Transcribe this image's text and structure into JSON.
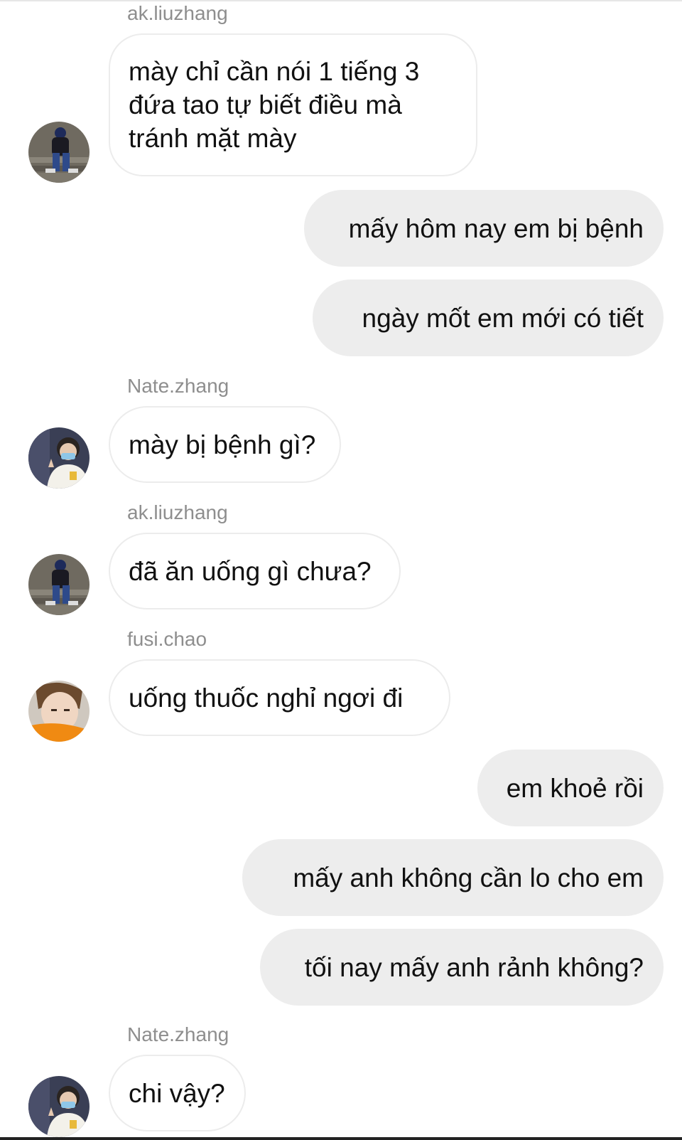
{
  "messages": [
    {
      "sender": "ak.liuzhang",
      "text": "mày chỉ cần nói 1 tiếng 3 đứa tao tự biết điều mà tránh mặt mày"
    },
    {
      "text": "mấy hôm nay em bị bệnh"
    },
    {
      "text": "ngày mốt em mới có tiết"
    },
    {
      "sender": "Nate.zhang",
      "text": "mày bị bệnh gì?"
    },
    {
      "sender": "ak.liuzhang",
      "text": "đã ăn uống gì chưa?"
    },
    {
      "sender": "fusi.chao",
      "text": "uống thuốc nghỉ ngơi đi"
    },
    {
      "text": "em khoẻ rồi"
    },
    {
      "text": "mấy anh không cần lo cho em"
    },
    {
      "text": "tối nay mấy anh rảnh không?"
    },
    {
      "sender": "Nate.zhang",
      "text": "chi vậy?"
    }
  ],
  "colors": {
    "incoming_bubble": "#ffffff",
    "outgoing_bubble": "#ededed",
    "sender_name": "#8e8e8e",
    "text": "#111111"
  },
  "avatars": {
    "ak_liuzhang": "profile-photo-person-sitting-on-steps",
    "nate_zhang": "profile-photo-person-with-mask",
    "fusi_chao": "profile-photo-person-orange-background"
  }
}
